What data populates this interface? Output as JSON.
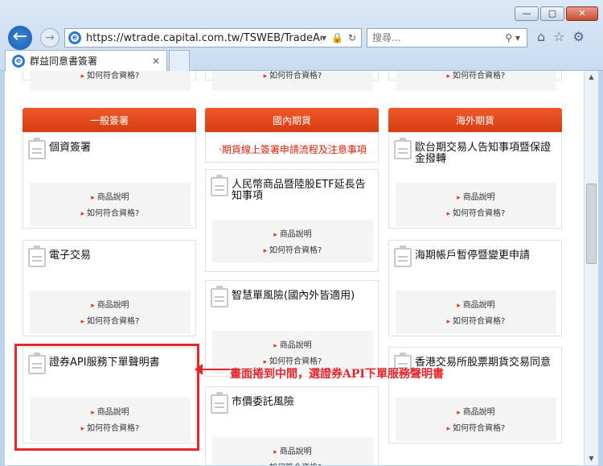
{
  "browser": {
    "url": "https://wtrade.capital.com.tw/TSWEB/TradeAgree/",
    "search_placeholder": "搜尋...",
    "tab_title": "群益同意書簽署",
    "min": "—",
    "max": "▢",
    "close": "✕"
  },
  "common_links": {
    "product_info": "商品說明",
    "qualify": "如何符合資格?"
  },
  "columns": [
    {
      "header": "一般簽署",
      "cards": [
        {
          "title": "個資簽署"
        },
        {
          "title": "電子交易"
        },
        {
          "title": "證券API服務下單聲明書"
        }
      ]
    },
    {
      "header": "國內期貨",
      "notice": "‧期貨線上簽署申請流程及注意事項",
      "cards": [
        {
          "title": "人民幣商品暨陸股ETF延長告知事項"
        },
        {
          "title": "智慧單風險(國內外皆適用)"
        },
        {
          "title": "市價委託風險"
        }
      ]
    },
    {
      "header": "海外期貨",
      "cards": [
        {
          "title": "歐台期交易人告知事項暨保證金撥轉"
        },
        {
          "title": "海期帳戶暫停暨變更申請"
        },
        {
          "title": "香港交易所股票期貨交易同意"
        }
      ]
    }
  ],
  "annotation": {
    "text": "畫面捲到中間，選證券API下單服務聲明書",
    "color": "#e4262d"
  }
}
